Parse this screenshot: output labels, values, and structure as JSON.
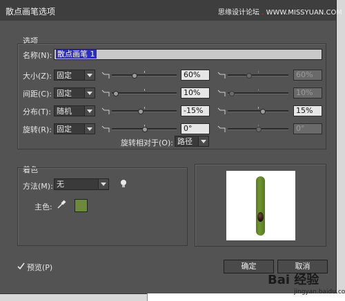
{
  "dialog": {
    "title": "散点画笔选项",
    "watermark_top_a": "思缘设计论坛",
    "watermark_top_b": "WWW.MISSYUAN.COM"
  },
  "options": {
    "section_label": "选项",
    "name_label": "名称(N):",
    "name_value": "散点画笔 1",
    "rows": [
      {
        "label": "大小(Z):",
        "method": "固定",
        "left_value": "60%",
        "right_value": "60%",
        "left_level": 0.33,
        "right_level": 0.33
      },
      {
        "label": "间距(C):",
        "method": "固定",
        "left_value": "10%",
        "right_value": "10%",
        "left_level": 0.02,
        "right_level": 0.02
      },
      {
        "label": "分布(T):",
        "method": "随机",
        "left_value": "-15%",
        "right_value": "15%",
        "left_level": 0.43,
        "right_level": 0.57
      },
      {
        "label": "旋转(R):",
        "method": "固定",
        "left_value": "0°",
        "right_value": "0°",
        "left_level": 0.5,
        "right_level": 0.5
      }
    ],
    "rotation_relative_label": "旋转相对于(O):",
    "rotation_relative_value": "路径"
  },
  "colorize": {
    "section_label": "着色",
    "method_label": "方法(M):",
    "method_value": "无",
    "key_color_label": "主色:",
    "key_color": "#6b8a3a"
  },
  "preview_label": "预览(P)",
  "buttons": {
    "ok": "确定",
    "cancel": "取消"
  },
  "watermark": {
    "brand": "Bai 经验",
    "url": "jingyan.baidu.com"
  }
}
